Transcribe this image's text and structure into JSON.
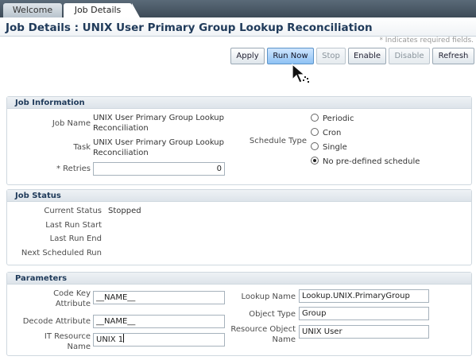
{
  "tabs": [
    {
      "label": "Welcome"
    },
    {
      "label": "Job Details"
    }
  ],
  "page": {
    "title": "Job Details : UNIX User Primary Group Lookup Reconciliation",
    "required_note": "* Indicates required fields."
  },
  "toolbar": {
    "apply": "Apply",
    "run_now": "Run Now",
    "stop": "Stop",
    "enable": "Enable",
    "disable": "Disable",
    "refresh": "Refresh"
  },
  "job_information": {
    "header": "Job Information",
    "job_name_label": "Job Name",
    "job_name_line1": "UNIX User Primary Group Lookup",
    "job_name_line2": "Reconciliation",
    "task_label": "Task",
    "task_line1": "UNIX User Primary Group Lookup",
    "task_line2": "Reconciliation",
    "retries_label": "* Retries",
    "retries_value": "0",
    "schedule_type_label": "Schedule Type",
    "schedule_options": [
      {
        "label": "Periodic",
        "selected": false
      },
      {
        "label": "Cron",
        "selected": false
      },
      {
        "label": "Single",
        "selected": false
      },
      {
        "label": "No pre-defined schedule",
        "selected": true
      }
    ]
  },
  "job_status": {
    "header": "Job Status",
    "current_status_label": "Current Status",
    "current_status_value": "Stopped",
    "last_run_start_label": "Last Run Start",
    "last_run_end_label": "Last Run End",
    "next_run_label": "Next Scheduled Run"
  },
  "parameters": {
    "header": "Parameters",
    "code_key_label_1": "Code Key",
    "code_key_label_2": "Attribute",
    "code_key_value": "__NAME__",
    "decode_label": "Decode Attribute",
    "decode_value": "__NAME__",
    "it_resource_label_1": "IT Resource",
    "it_resource_label_2": "Name",
    "it_resource_value": "UNIX 1",
    "lookup_name_label": "Lookup Name",
    "lookup_name_value": "Lookup.UNIX.PrimaryGroup",
    "object_type_label": "Object Type",
    "object_type_value": "Group",
    "resource_object_label_1": "Resource Object",
    "resource_object_label_2": "Name",
    "resource_object_value": "UNIX User"
  }
}
